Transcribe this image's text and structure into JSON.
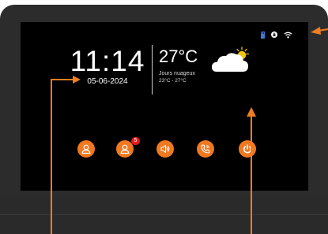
{
  "clock": {
    "time": "11:14",
    "date": "05-06-2024"
  },
  "weather": {
    "temperature": "27°C",
    "condition": "Jours nuageux",
    "range": "23°C - 27°C",
    "icon": "partly-cloudy-icon"
  },
  "status_icons": [
    "sd-card-icon",
    "lock-icon",
    "wifi-icon"
  ],
  "buttons": [
    {
      "name": "contacts-button",
      "icon": "user-icon"
    },
    {
      "name": "messages-button",
      "icon": "user-icon",
      "badge": "5"
    },
    {
      "name": "volume-button",
      "icon": "speaker-icon"
    },
    {
      "name": "call-button",
      "icon": "phone-icon"
    },
    {
      "name": "power-button",
      "icon": "power-icon"
    }
  ],
  "colors": {
    "accent": "#f07820",
    "badge": "#e31b1b",
    "annotation": "#ef7d22",
    "sd_icon": "#3a7bd5",
    "screen": "#000000",
    "bezel": "#2c2c2d"
  }
}
